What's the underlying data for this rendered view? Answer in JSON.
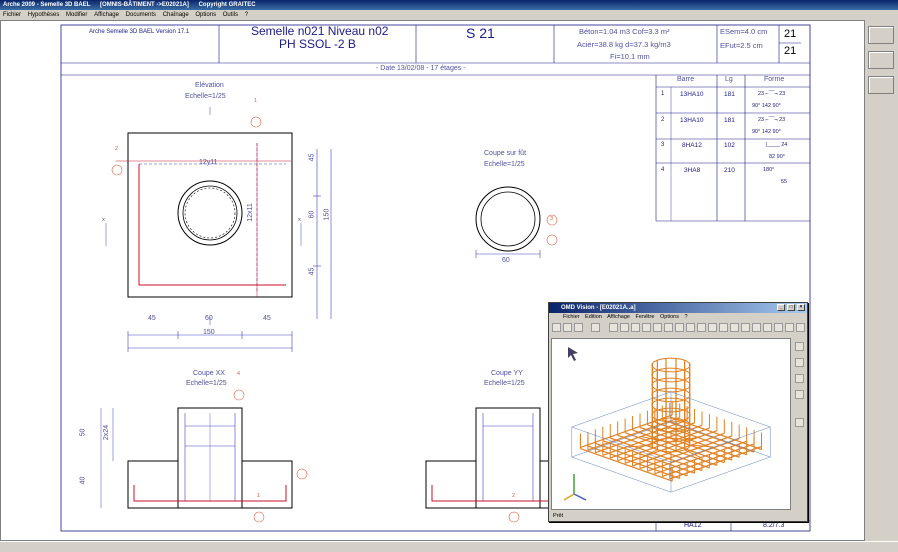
{
  "window": {
    "title": "Arche 2009 - Semelle 3D BAEL",
    "doc": "[OMNIS-BÂTIMENT ->E02021A]",
    "copyright": "Copyright GRAITEC"
  },
  "menu": [
    "Fichier",
    "Hypothèses",
    "Modifier",
    "Affichage",
    "Documents",
    "Chaînage",
    "Options",
    "Outils",
    "?"
  ],
  "header": {
    "software": "Arche Semelle 3D BAEL Version 17.1",
    "title_line1": "Semelle n021 Niveau n02",
    "title_line2": "PH SSOL -2 B",
    "code": "S 21",
    "beton": "Béton=1.04 m3 Cof=3.3 m²",
    "acier": "Acier=38.8 kg d=37.3 kg/m3",
    "fi": "Fi=10.1 mm",
    "esem": "ESem=4.0 cm",
    "efut": "EFut=2.5 cm",
    "page_top": "21",
    "page_bottom": "21",
    "date": "- Date 13/02/08 - 17 étages -"
  },
  "table": {
    "headers": [
      "Barre",
      "Lg",
      "Forme"
    ],
    "rows": [
      {
        "n": "1",
        "barre": "13HA10",
        "lg": "181",
        "forme_top": "23 ⌐‾‾‾¬ 23",
        "forme_bot": "90°  142  90°"
      },
      {
        "n": "2",
        "barre": "13HA10",
        "lg": "181",
        "forme_top": "23 ⌐‾‾‾¬ 23",
        "forme_bot": "90°  142  90°"
      },
      {
        "n": "3",
        "barre": "8HA12",
        "lg": "102",
        "forme_top": "|____ 24",
        "forme_bot": "82  90°"
      },
      {
        "n": "4",
        "barre": "3HA8",
        "lg": "210",
        "forme_top": "180°",
        "forme_bot": "55"
      }
    ]
  },
  "drawings": {
    "elevation_title": "Elévation",
    "elevation_scale": "Echelle=1/25",
    "futcut_title": "Coupe sur fût",
    "futcut_scale": "Echelle=1/25",
    "xx_title": "Coupe XX",
    "xx_scale": "Echelle=1/25",
    "yy_title": "Coupe YY",
    "yy_scale": "Echelle=1/25",
    "dim_12y11": "12y11",
    "dim_12x11": "12x11",
    "dim_45a": "45",
    "dim_60": "60",
    "dim_45b": "45",
    "dim_150": "150",
    "dim_v45a": "45",
    "dim_v60": "60",
    "dim_v45b": "45",
    "dim_v150": "150",
    "dim_fut60": "60",
    "dim_50": "50",
    "dim_2x24": "2x24",
    "dim_40": "40",
    "marks": [
      "1",
      "2",
      "3",
      "4",
      "1",
      "2"
    ],
    "x_label": "x"
  },
  "bottom": {
    "type": "HA12",
    "dims": "8.2/7.3",
    "n": "N"
  },
  "omd": {
    "title": "OMD Vision - [E02021A..a]",
    "menu": [
      "Fichier",
      "Edition",
      "Affichage",
      "Fenêtre",
      "Options",
      "?"
    ],
    "status": "Prêt",
    "buttons": {
      "min": "_",
      "max": "□",
      "close": "×"
    }
  },
  "colors": {
    "line": "#1a1a8a",
    "rebar": "#c8102e",
    "dim": "#4040c0",
    "steel": "#e08020",
    "accent": "#0a246a"
  }
}
